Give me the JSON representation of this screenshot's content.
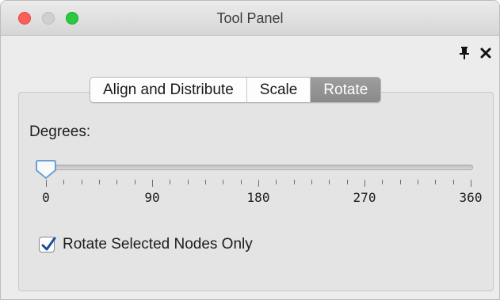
{
  "window": {
    "title": "Tool Panel"
  },
  "tabs": [
    {
      "label": "Align and Distribute",
      "selected": false
    },
    {
      "label": "Scale",
      "selected": false
    },
    {
      "label": "Rotate",
      "selected": true
    }
  ],
  "rotate": {
    "degrees_label": "Degrees:",
    "slider": {
      "min": 0,
      "max": 360,
      "value": 0,
      "major_ticks": [
        0,
        90,
        180,
        270,
        360
      ],
      "minor_step": 15
    },
    "checkbox": {
      "label": "Rotate Selected Nodes Only",
      "checked": true
    }
  },
  "icons": {
    "pin": "pin-icon",
    "close": "close-icon"
  }
}
